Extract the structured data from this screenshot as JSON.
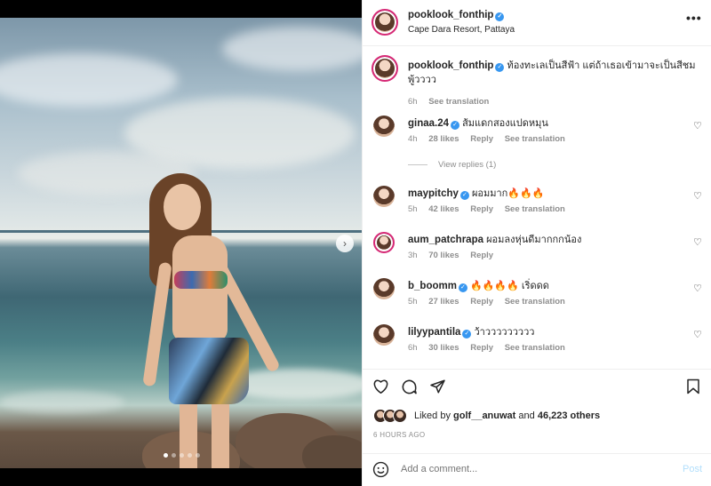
{
  "post": {
    "username": "pooklook_fonthip",
    "location": "Cape Dara Resort, Pattaya",
    "more_label": "•••",
    "carousel_next": "›",
    "carousel_dots": 5,
    "carousel_active_index": 0
  },
  "caption": {
    "username": "pooklook_fonthip",
    "text": "ท้องทะเลเป็นสีฟ้า แต่ถ้าเธอเข้ามาจะเป็นสีชมพู้วววว",
    "time": "6h",
    "see_translation": "See translation"
  },
  "comments": [
    {
      "username": "ginaa.24",
      "text": "ส้มแดกสองแปดหมุน",
      "time": "4h",
      "likes": "28 likes",
      "reply": "Reply",
      "see_translation": "See translation"
    },
    {
      "username": "maypitchy",
      "text": "ผอมมาก🔥🔥🔥",
      "time": "5h",
      "likes": "42 likes",
      "reply": "Reply",
      "see_translation": "See translation"
    },
    {
      "username": "aum_patchrapa",
      "text": "ผอมลงหุ่นดีมากกกน้อง",
      "time": "3h",
      "likes": "70 likes",
      "reply": "Reply",
      "see_translation": ""
    },
    {
      "username": "b_boomm",
      "text": "🔥🔥🔥🔥 เริ่ดดด",
      "time": "5h",
      "likes": "27 likes",
      "reply": "Reply",
      "see_translation": "See translation"
    },
    {
      "username": "lilyypantila",
      "text": "ว้าววววววววว",
      "time": "6h",
      "likes": "30 likes",
      "reply": "Reply",
      "see_translation": "See translation"
    }
  ],
  "view_replies": "View replies (1)",
  "actions": {
    "like_icon": "heart-outline",
    "comment_icon": "comment-bubble",
    "share_icon": "paper-plane",
    "save_icon": "bookmark",
    "liked_by_prefix": "Liked by",
    "liked_by_user": "golf__anuwat",
    "liked_by_and": "and",
    "liked_by_others": "46,223 others",
    "timestamp": "6 HOURS AGO"
  },
  "add_comment": {
    "placeholder": "Add a comment...",
    "post_label": "Post"
  },
  "colors": {
    "verified": "#3897f0",
    "muted": "#8e8e8e",
    "post_disabled": "#b2dffc",
    "story_ring": "#d62976"
  }
}
